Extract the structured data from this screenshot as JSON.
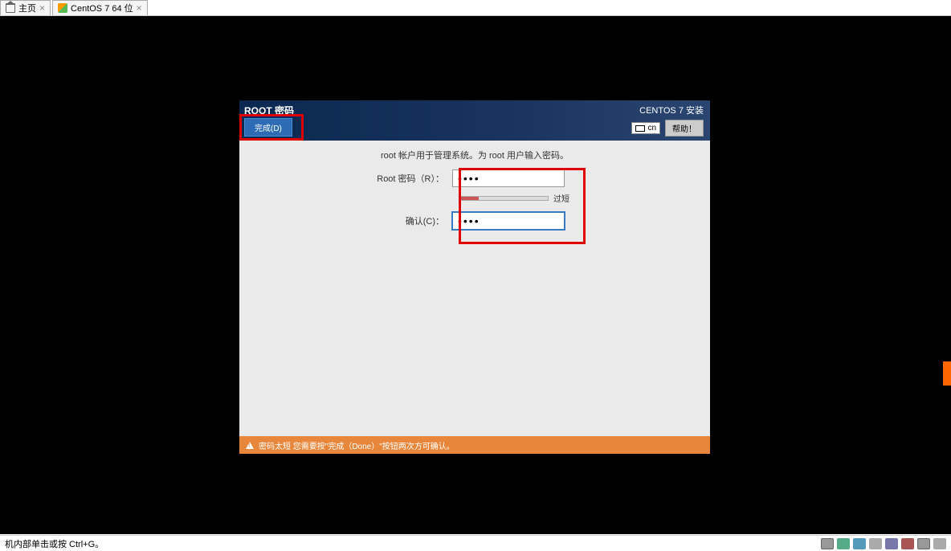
{
  "tabs": {
    "home": {
      "label": "主页"
    },
    "vm": {
      "label": "CentOS 7 64 位"
    }
  },
  "installer": {
    "title": "ROOT 密码",
    "subtitle": "CENTOS 7 安装",
    "done_button": "完成(D)",
    "lang_indicator": "cn",
    "help_button": "帮助！",
    "intro": "root 帐户用于管理系统。为 root 用户输入密码。",
    "form": {
      "password_label": "Root 密码（R）：",
      "password_value": "••••",
      "confirm_label": "确认(C)：",
      "confirm_value": "••••",
      "strength_text": "过短"
    },
    "warning": "密码太短 您需要按\"完成（Done）\"按钮两次方可确认。"
  },
  "status_bar": {
    "hint": "机内部单击或按 Ctrl+G。"
  }
}
